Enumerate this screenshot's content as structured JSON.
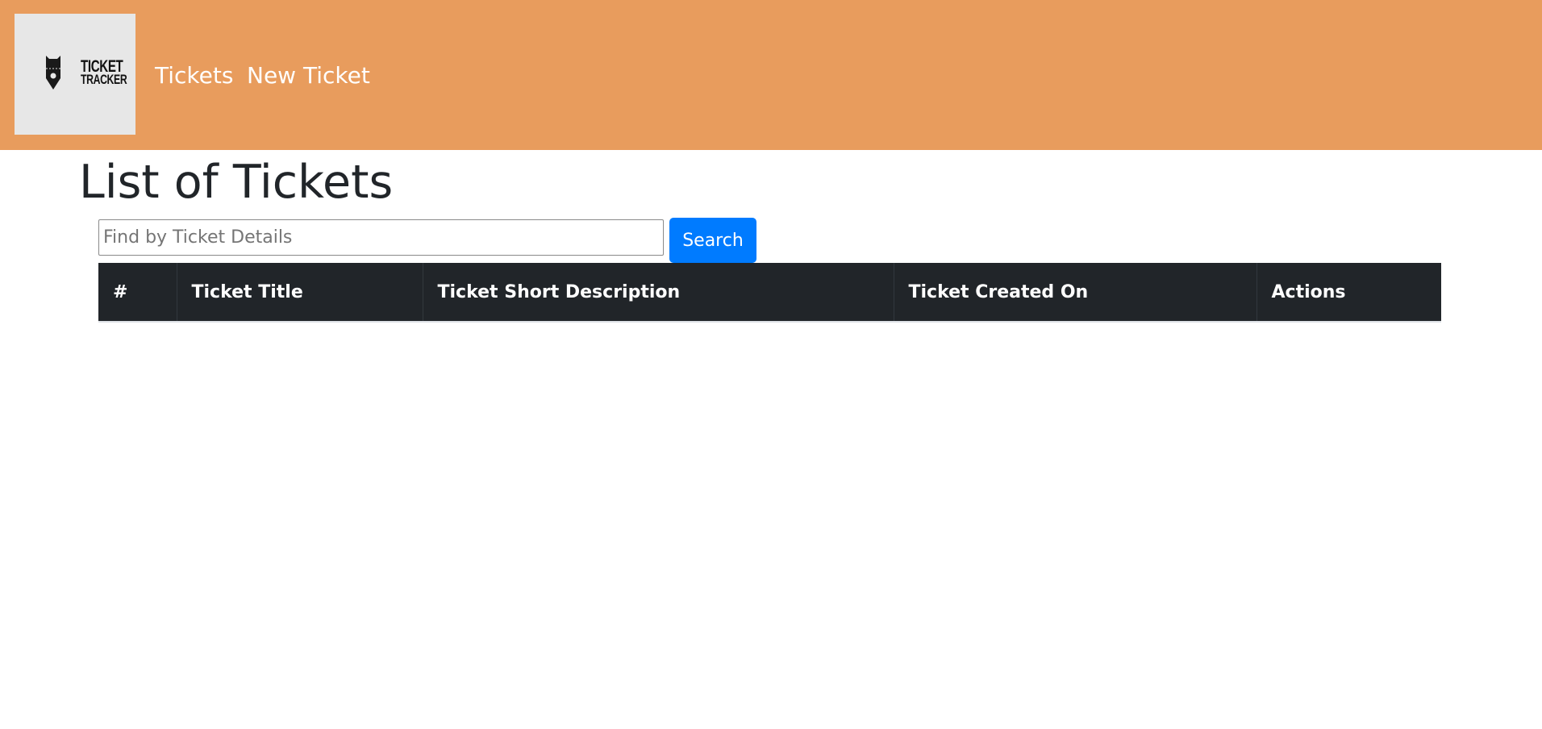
{
  "navbar": {
    "background_color": "#e89c5d",
    "logo": {
      "icon": "ticket-tracker-logo-icon",
      "line1": "TICKET",
      "line2": "TRACKER"
    },
    "links": [
      {
        "label": "Tickets"
      },
      {
        "label": "New Ticket"
      }
    ]
  },
  "main": {
    "title": "List of Tickets",
    "search": {
      "placeholder": "Find by Ticket Details",
      "value": "",
      "button_label": "Search",
      "button_color": "#007bff"
    },
    "table": {
      "columns": [
        "#",
        "Ticket Title",
        "Ticket Short Description",
        "Ticket Created On",
        "Actions"
      ],
      "rows": []
    }
  }
}
